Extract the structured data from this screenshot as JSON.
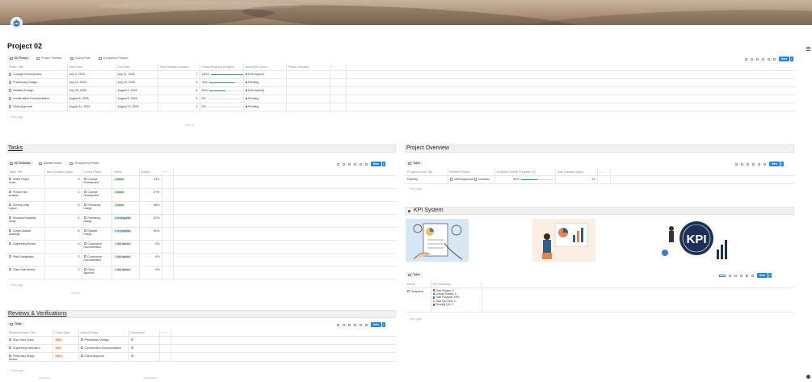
{
  "page": {
    "title": "Project 02"
  },
  "phases": {
    "tabs": [
      "All Phases",
      "Project Timeline",
      "Critical Path",
      "Completed Phases"
    ],
    "new_label": "New",
    "columns": [
      "Phase Title",
      "Start Date",
      "End Date",
      "Total Subtask Duration",
      "Phase Progress (Weight)",
      "Actual QA Check",
      "Phase Criticality"
    ],
    "rows": [
      {
        "title": "Concept Development",
        "start": "July 3, 2025",
        "end": "July 11, 2025",
        "duration": "7",
        "progress_label": "100%",
        "progress": 1.0,
        "qa": "Not required",
        "qa_color": "#2a9d5a"
      },
      {
        "title": "Preliminary Design",
        "start": "July 14, 2025",
        "end": "July 24, 2025",
        "duration": "9",
        "progress_label": "78%",
        "progress": 0.78,
        "qa": "Pending",
        "qa_color": "#d44c47"
      },
      {
        "title": "Detailed Design",
        "start": "July 25, 2025",
        "end": "August 1, 2025",
        "duration": "6",
        "progress_label": "50%",
        "progress": 0.5,
        "qa": "Not required",
        "qa_color": "#2a9d5a"
      },
      {
        "title": "Construction Documentation",
        "start": "August 4, 2025",
        "end": "August 8, 2025",
        "duration": "5",
        "progress_label": "0%",
        "progress": 0,
        "qa": "Pending",
        "qa_color": "#d44c47"
      },
      {
        "title": "Client Approval",
        "start": "August 11, 2025",
        "end": "August 12, 2025",
        "duration": "2",
        "progress_label": "0%",
        "progress": 0,
        "qa": "Pending",
        "qa_color": "#d44c47"
      }
    ],
    "new_page": "+ New page",
    "sum_label": "SUM 29"
  },
  "tasks": {
    "title": "Tasks",
    "tabs": [
      "All Subtasks",
      "Kanban board",
      "Grouped by Phase"
    ],
    "new_label": "New",
    "columns": [
      "Tasks Title",
      "Task Duration (days)",
      "Linked Phase",
      "Status",
      "Weight..."
    ],
    "rows": [
      {
        "title": [
          "Define Project",
          "Goals"
        ],
        "days": "3",
        "phase": [
          "Concept",
          "Development"
        ],
        "status": "Done",
        "weight": "43%"
      },
      {
        "title": [
          "Perform Site",
          "Analysis"
        ],
        "days": "4",
        "phase": [
          "Concept",
          "Development"
        ],
        "status": "Done",
        "weight": "57%"
      },
      {
        "title": [
          "Develop Initial",
          "Layout"
        ],
        "days": "5",
        "phase": [
          "Preliminary",
          "Design"
        ],
        "status": "Done",
        "weight": "56%"
      },
      {
        "title": [
          "Structural Feasibility",
          "Study"
        ],
        "days": "4",
        "phase": [
          "Preliminary",
          "Design"
        ],
        "status": "In progress",
        "weight": "22%"
      },
      {
        "title": [
          "Create Detailed",
          "Drawings"
        ],
        "days": "6",
        "phase": [
          "Detailed",
          "Design"
        ],
        "status": "In progress",
        "weight": "50%"
      },
      {
        "title": [
          "Engineering Review",
          ""
        ],
        "days": "5",
        "phase": [
          "Construction",
          "Documentation"
        ],
        "status": "Not started",
        "weight": "0%"
      },
      {
        "title": [
          "Final Coordination",
          ""
        ],
        "days": "2",
        "phase": [
          "Construction",
          "Documentation"
        ],
        "status": "Not started",
        "weight": "0%"
      },
      {
        "title": [
          "Client Final Review",
          ""
        ],
        "days": "2",
        "phase": [
          "Client",
          "Approval"
        ],
        "status": "Not started",
        "weight": "0%"
      }
    ],
    "new_page": "+ New page",
    "sum_label": "SUM 29"
  },
  "overview": {
    "title": "Project Overview",
    "tab": "Table",
    "new_label": "New",
    "columns": [
      "Progress Entry Title",
      "Related Phases",
      "Weighted Global Progress (%)",
      "Total Duration (days)"
    ],
    "row": {
      "title": "Delivery...",
      "phases": [
        "Client Approval",
        "Construc"
      ],
      "progress_label": "50%",
      "progress": 0.5,
      "duration": "29"
    },
    "new_page": "+ New page"
  },
  "kpi": {
    "title": "KPI System",
    "tab": "Table",
    "new_label": "New",
    "columns": [
      "Name",
      "KPI Summary"
    ],
    "row_name": "Snapshot",
    "summary": [
      "Total Phases: 5",
      "Critical Phases: 0",
      "Total Progress: 59%",
      "Total QA Done: 0",
      "Pending QA: 3"
    ],
    "summary_colors": [
      "#d44c47",
      "#2a9d5a",
      "#2383e2",
      "#e9a23b",
      "#d44c47"
    ],
    "new_page": "+ New page"
  },
  "reviews": {
    "title": "Reviews & Verifications",
    "tab": "Table",
    "new_label": "New",
    "columns": [
      "Revision/Check Title",
      "Check Type",
      "Linked Phase",
      "Completed"
    ],
    "rows": [
      {
        "title": [
          "Final Client Check",
          ""
        ],
        "type": "Rev.",
        "phase": "Preliminary Design"
      },
      {
        "title": [
          "Engineering Verification",
          ""
        ],
        "type": "Ver.",
        "phase": "Construction Documentation"
      },
      {
        "title": [
          "Preliminary Design",
          "Review"
        ],
        "type": "Rev.",
        "phase": "Client Approval"
      }
    ],
    "new_page": "+ New page",
    "count_left": "COUNT 3",
    "count_right": "CHECKED 0"
  }
}
